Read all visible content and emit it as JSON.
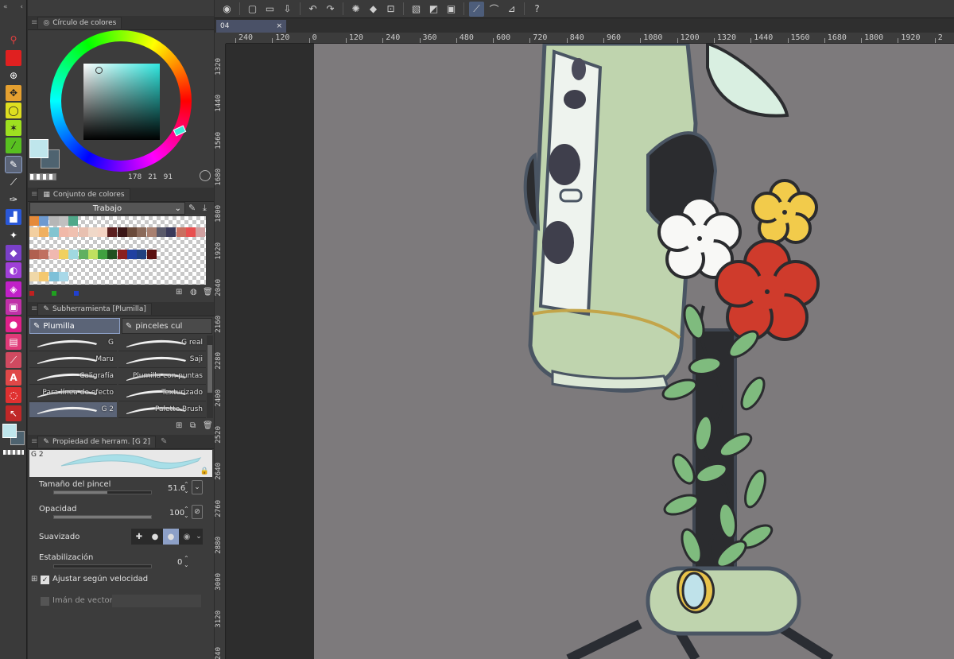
{
  "color_circle": {
    "title": "Círculo de colores",
    "h": "178",
    "s": "21",
    "v": "91"
  },
  "color_set": {
    "title": "Conjunto de colores",
    "set_name": "Trabajo"
  },
  "subtool": {
    "title": "Subherramienta [Plumilla]",
    "tab1": "Plumilla",
    "tab2": "pinceles cul",
    "brushes_left": [
      "G",
      "Maru",
      "Caligrafía",
      "Para línea de efecto",
      "G 2"
    ],
    "brushes_right": [
      "G real",
      "Saji",
      "Plumilla con puntas",
      "Texturizado",
      "Palette Brush"
    ]
  },
  "tool_property": {
    "title": "Propiedad de herram. [G 2]",
    "preview_label": "G 2",
    "brush_size_label": "Tamaño del pincel",
    "brush_size_value": "51.6",
    "opacity_label": "Opacidad",
    "opacity_value": "100",
    "smoothing_label": "Suavizado",
    "stabilization_label": "Estabilización",
    "stabilization_value": "0",
    "adjust_speed_label": "Ajustar según velocidad",
    "vector_magnet_label": "Imán de vectores",
    "brush_size_pct": 0.55,
    "opacity_pct": 1.0
  },
  "document": {
    "tab_name": "04"
  },
  "ruler_h": [
    "240",
    "120",
    "0",
    "120",
    "240",
    "360",
    "480",
    "600",
    "720",
    "840",
    "960",
    "1080",
    "1200",
    "1320",
    "1440",
    "1560",
    "1680",
    "1800",
    "1920",
    "2"
  ],
  "ruler_v": [
    "1320",
    "1440",
    "1560",
    "1680",
    "1800",
    "1920",
    "2040",
    "2160",
    "2280",
    "2400",
    "2520",
    "2640",
    "2760",
    "2880",
    "3000",
    "3120",
    "3240"
  ],
  "colors": {
    "main_color": "#bfe6ec",
    "sub_color": "#4e6370",
    "canvas_bg": "#7d7a7c",
    "selection": "#5b6477"
  }
}
